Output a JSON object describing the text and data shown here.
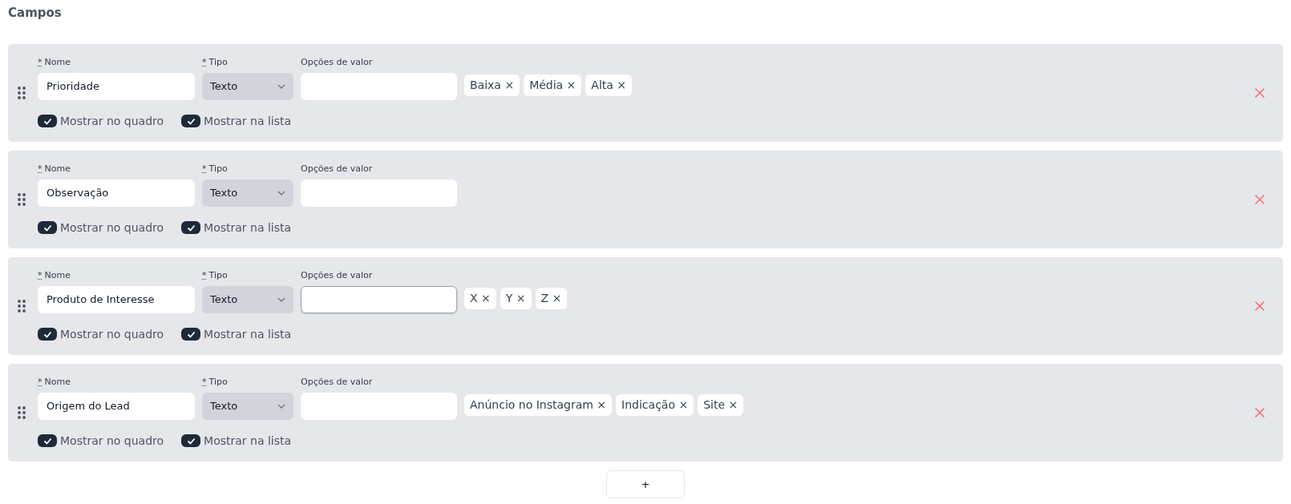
{
  "title": "Campos",
  "fields": [
    {
      "name_label": {
        "text": "Nome",
        "required": true
      },
      "name": "Prioridade",
      "type_label": {
        "text": "Tipo",
        "required": true
      },
      "type": "Texto",
      "options_label": {
        "text": "Opções de valor"
      },
      "option_input": {
        "focused": false
      },
      "options": [
        "Baixa",
        "Média",
        "Alta"
      ],
      "checkboxes": [
        {
          "label": "Mostrar no quadro",
          "checked": true
        },
        {
          "label": "Mostrar na lista",
          "checked": true
        }
      ]
    },
    {
      "name_label": {
        "text": "Nome",
        "required": true
      },
      "name": "Observação",
      "type_label": {
        "text": "Tipo",
        "required": true
      },
      "type": "Texto",
      "options_label": {
        "text": "Opções de valor"
      },
      "option_input": {
        "focused": false
      },
      "checkboxes": [
        {
          "label": "Mostrar no quadro",
          "checked": true
        },
        {
          "label": "Mostrar na lista",
          "checked": true
        }
      ]
    },
    {
      "name_label": {
        "text": "Nome",
        "required": true
      },
      "name": "Produto de Interesse",
      "type_label": {
        "text": "Tipo",
        "required": true
      },
      "type": "Texto",
      "options_label": {
        "text": "Opções de valor"
      },
      "option_input": {
        "focused": true
      },
      "options": [
        "X",
        "Y",
        "Z"
      ],
      "checkboxes": [
        {
          "label": "Mostrar no quadro",
          "checked": true
        },
        {
          "label": "Mostrar na lista",
          "checked": true
        }
      ]
    },
    {
      "name_label": {
        "text": "Nome",
        "required": true
      },
      "name": "Origem do Lead",
      "type_label": {
        "text": "Tipo",
        "required": true
      },
      "type": "Texto",
      "options_label": {
        "text": "Opções de valor"
      },
      "option_input": {
        "focused": false
      },
      "options": [
        "Anúncio no Instagram",
        "Indicação",
        "Site"
      ],
      "checkboxes": [
        {
          "label": "Mostrar no quadro",
          "checked": true
        },
        {
          "label": "Mostrar na lista",
          "checked": true
        }
      ]
    }
  ],
  "add_button": "+",
  "required_mark": "*",
  "remove_mark": "×"
}
